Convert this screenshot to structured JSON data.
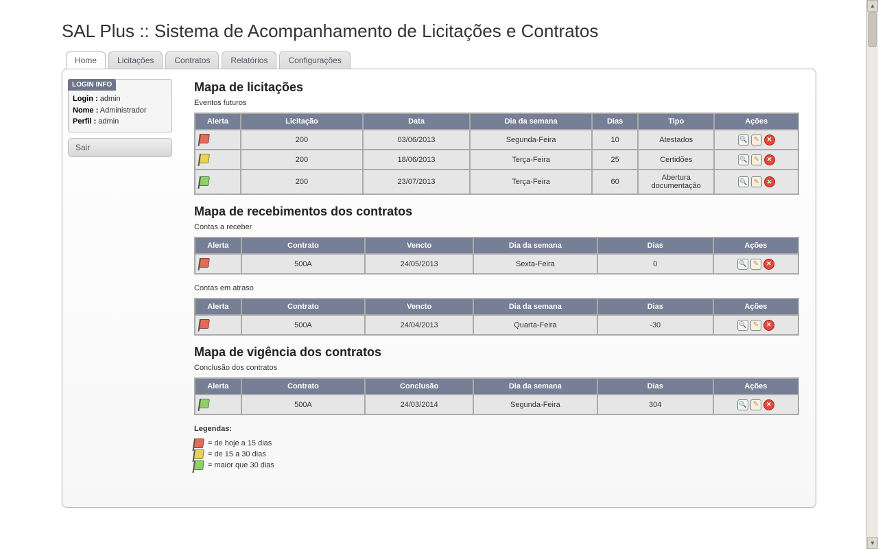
{
  "app_title": "SAL Plus :: Sistema de Acompanhamento de Licitações e Contratos",
  "tabs": [
    "Home",
    "Licitações",
    "Contratos",
    "Relatórios",
    "Configurações"
  ],
  "active_tab": 0,
  "login_info": {
    "header": "LOGIN INFO",
    "login_label": "Login :",
    "login_value": "admin",
    "nome_label": "Nome :",
    "nome_value": "Administrador",
    "perfil_label": "Perfil :",
    "perfil_value": "admin"
  },
  "logout_label": "Sair",
  "sections": {
    "licitacoes": {
      "title": "Mapa de licitações",
      "subtitle": "Eventos futuros",
      "headers": [
        "Alerta",
        "Licitação",
        "Data",
        "Dia da semana",
        "Dias",
        "Tipo",
        "Ações"
      ],
      "rows": [
        {
          "flag": "red",
          "licitacao": "200",
          "data": "03/06/2013",
          "dia": "Segunda-Feira",
          "dias": "10",
          "tipo": "Atestados"
        },
        {
          "flag": "yellow",
          "licitacao": "200",
          "data": "18/06/2013",
          "dia": "Terça-Feira",
          "dias": "25",
          "tipo": "Certidões"
        },
        {
          "flag": "green",
          "licitacao": "200",
          "data": "23/07/2013",
          "dia": "Terça-Feira",
          "dias": "60",
          "tipo": "Abertura documentação"
        }
      ]
    },
    "recebimentos": {
      "title": "Mapa de recebimentos dos contratos",
      "sub1": "Contas a receber",
      "headers": [
        "Alerta",
        "Contrato",
        "Vencto",
        "Dia da semana",
        "Dias",
        "Ações"
      ],
      "rows1": [
        {
          "flag": "red",
          "contrato": "500A",
          "vencto": "24/05/2013",
          "dia": "Sexta-Feira",
          "dias": "0"
        }
      ],
      "sub2": "Contas em atraso",
      "rows2": [
        {
          "flag": "red",
          "contrato": "500A",
          "vencto": "24/04/2013",
          "dia": "Quarta-Feira",
          "dias": "-30"
        }
      ]
    },
    "vigencia": {
      "title": "Mapa de vigência dos contratos",
      "subtitle": "Conclusão dos contratos",
      "headers": [
        "Alerta",
        "Contrato",
        "Conclusão",
        "Dia da semana",
        "Dias",
        "Ações"
      ],
      "rows": [
        {
          "flag": "green",
          "contrato": "500A",
          "conclusao": "24/03/2014",
          "dia": "Segunda-Feira",
          "dias": "304"
        }
      ]
    }
  },
  "legend": {
    "title": "Legendas:",
    "items": [
      {
        "flag": "red",
        "text": "= de hoje a 15 dias"
      },
      {
        "flag": "yellow",
        "text": "= de 15 a 30 dias"
      },
      {
        "flag": "green",
        "text": "= maior que 30 dias"
      }
    ]
  }
}
